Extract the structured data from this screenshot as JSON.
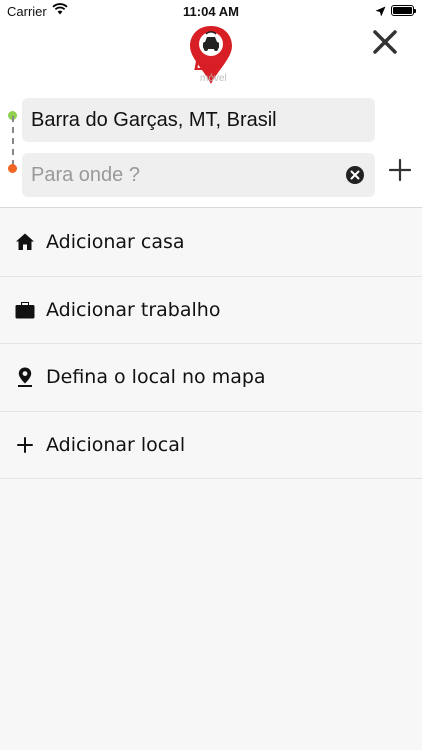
{
  "status_bar": {
    "carrier": "Carrier",
    "time": "11:04 AM",
    "wifi_icon": "wifi-icon",
    "location_icon": "location-arrow-icon",
    "battery_level": 1.0
  },
  "header": {
    "logo": {
      "text": "BG",
      "sub": "móvel"
    },
    "close_icon": "close-icon"
  },
  "route": {
    "origin_value": "Barra do Garças, MT, Brasil",
    "destination_value": "",
    "destination_placeholder": "Para onde ?",
    "clear_icon": "clear-circle-icon",
    "add_stop_icon": "plus-icon",
    "origin_color": "#8fd14f",
    "destination_color": "#f26522"
  },
  "shortcuts": [
    {
      "label": "Adicionar casa",
      "icon": "home-icon"
    },
    {
      "label": "Adicionar trabalho",
      "icon": "briefcase-icon"
    },
    {
      "label": "Defina o local no mapa",
      "icon": "map-pin-icon"
    },
    {
      "label": "Adicionar local",
      "icon": "plus-icon"
    }
  ],
  "colors": {
    "brand_red": "#d81f26"
  }
}
